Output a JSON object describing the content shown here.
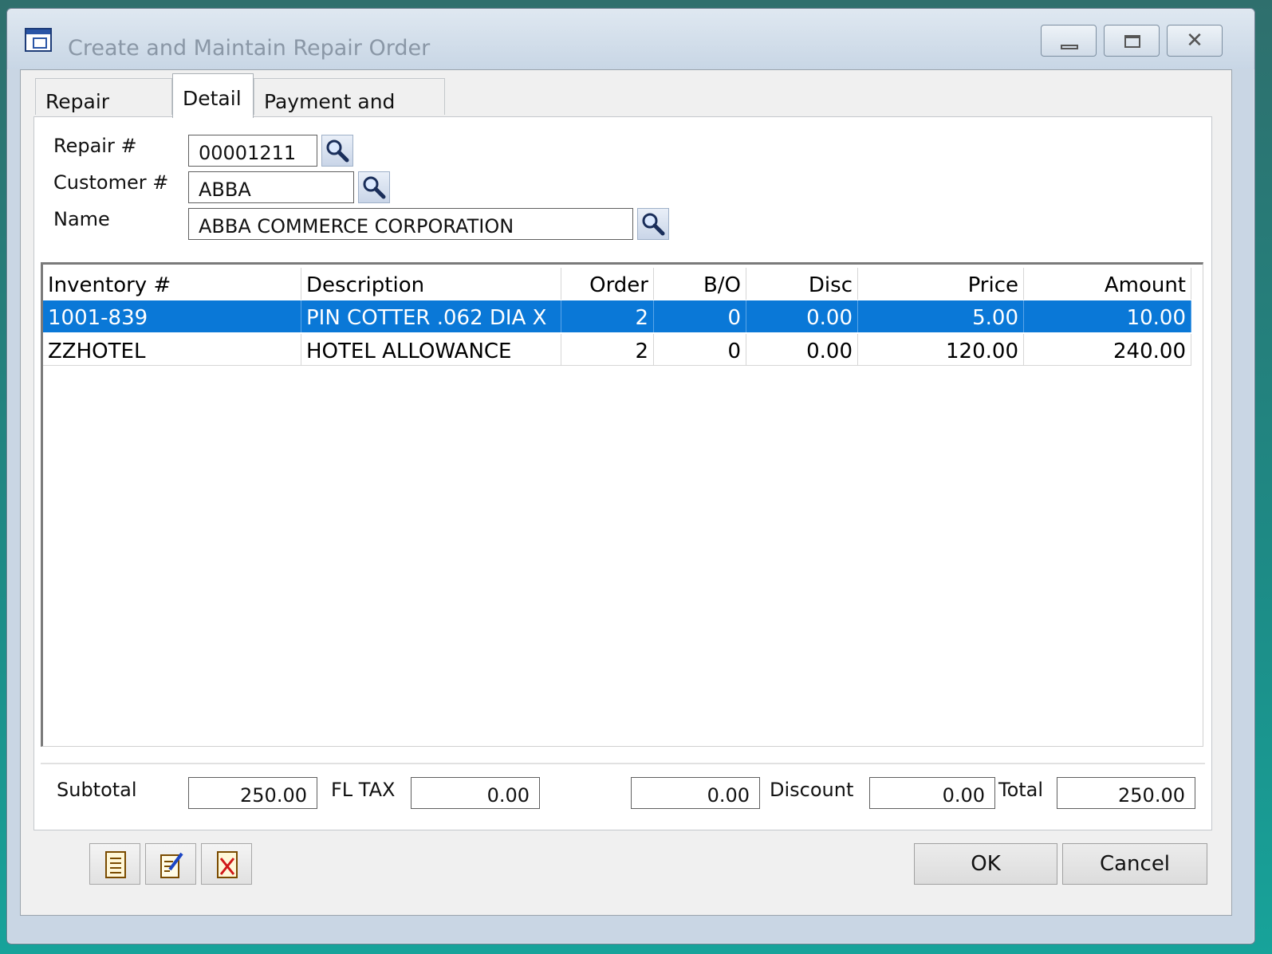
{
  "window": {
    "title": "Create and Maintain Repair Order"
  },
  "tabs": [
    {
      "label": "Repair Order"
    },
    {
      "label": "Detail"
    },
    {
      "label": "Payment and Notes"
    }
  ],
  "header_fields": {
    "repair": {
      "label": "Repair #",
      "value": "00001211"
    },
    "customer": {
      "label": "Customer #",
      "value": "ABBA"
    },
    "name": {
      "label": "Name",
      "value": "ABBA COMMERCE CORPORATION"
    }
  },
  "grid": {
    "columns": [
      "Inventory #",
      "Description",
      "Order",
      "B/O",
      "Disc",
      "Price",
      "Amount"
    ],
    "rows": [
      {
        "inventory": "1001-839",
        "description": "PIN COTTER .062 DIA X",
        "order": "2",
        "bo": "0",
        "disc": "0.00",
        "price": "5.00",
        "amount": "10.00",
        "selected": true
      },
      {
        "inventory": "ZZHOTEL",
        "description": "HOTEL ALLOWANCE",
        "order": "2",
        "bo": "0",
        "disc": "0.00",
        "price": "120.00",
        "amount": "240.00",
        "selected": false
      }
    ]
  },
  "totals": {
    "subtotal_label": "Subtotal",
    "subtotal": "250.00",
    "tax_label": "FL TAX",
    "tax": "0.00",
    "other": "0.00",
    "discount_label": "Discount",
    "discount": "0.00",
    "total_label": "Total",
    "total": "250.00"
  },
  "toolbar": {
    "icons": [
      "notes-icon",
      "edit-icon",
      "delete-icon"
    ]
  },
  "buttons": {
    "ok": "OK",
    "cancel": "Cancel"
  }
}
